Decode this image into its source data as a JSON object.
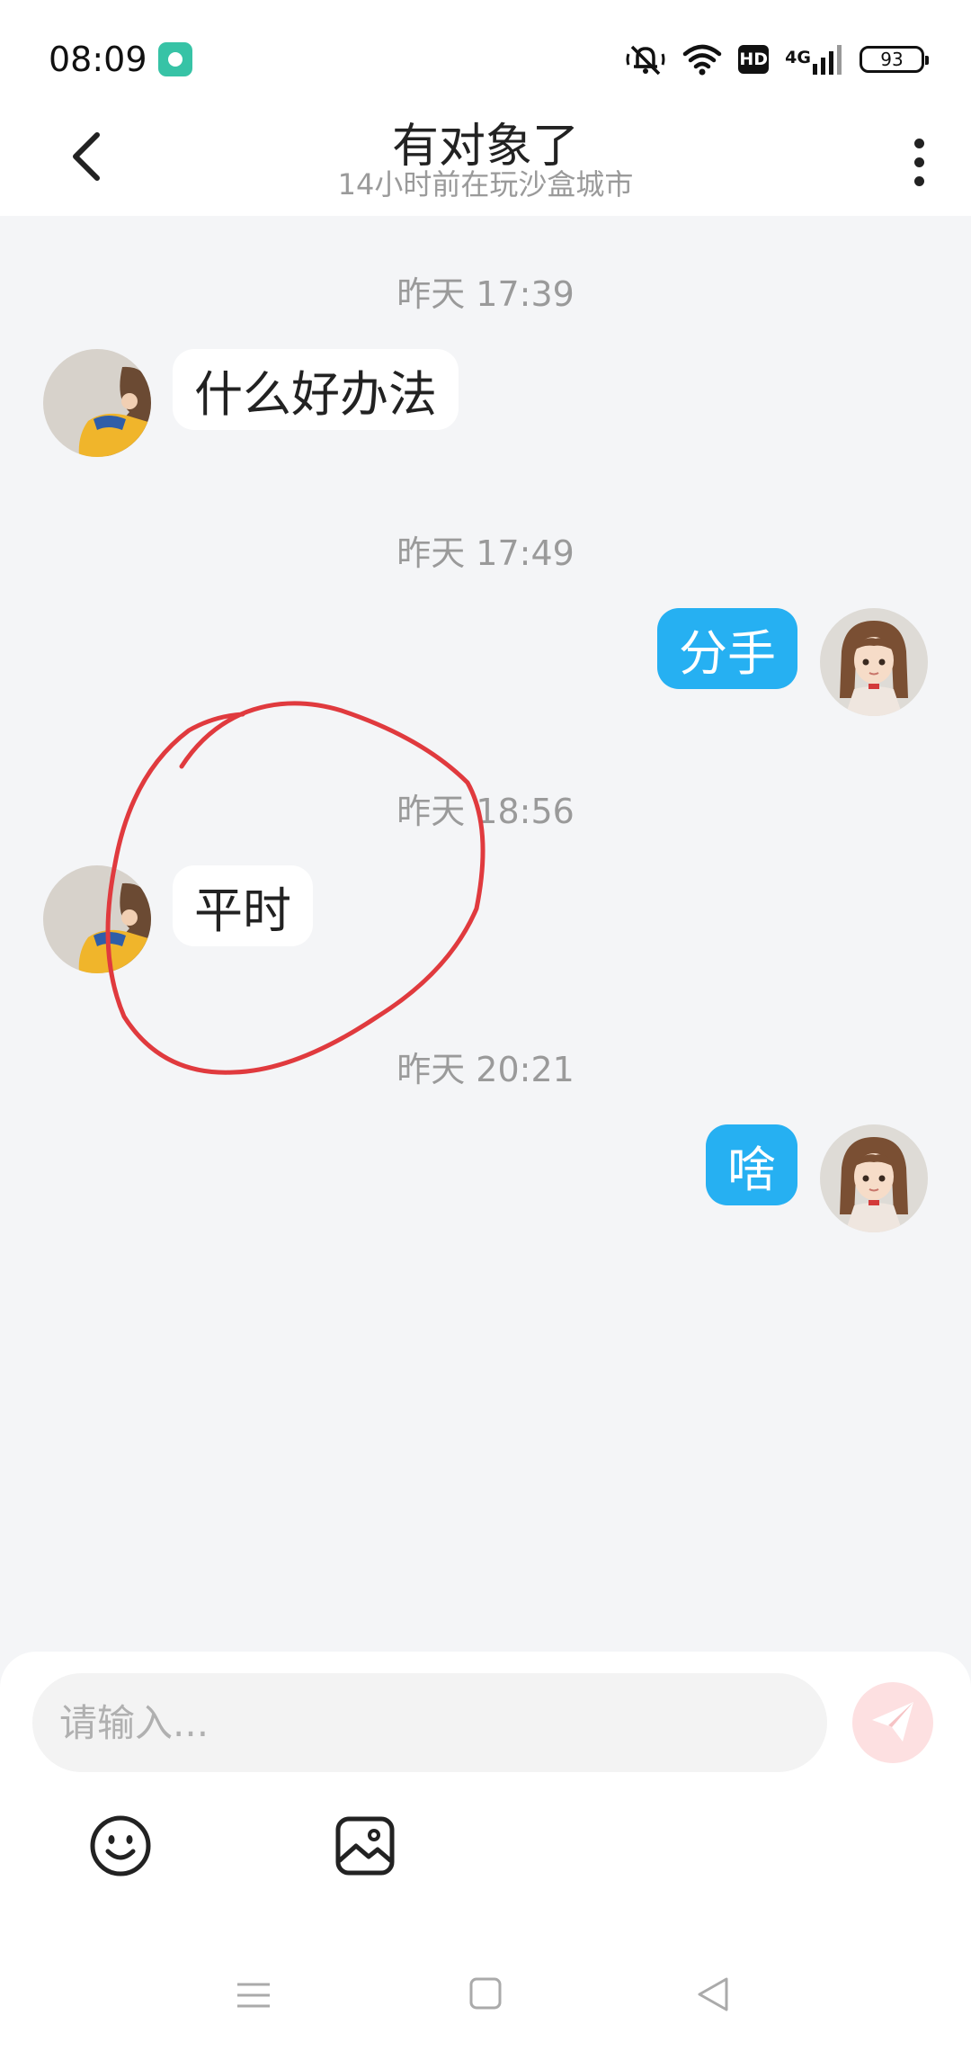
{
  "status_bar": {
    "time": "08:09",
    "hd": "HD",
    "network": "4G",
    "battery": "93",
    "icons": [
      "app-notification-icon",
      "mute-icon",
      "wifi-icon",
      "hd-icon",
      "signal-icon",
      "battery-icon"
    ]
  },
  "header": {
    "title": "有对象了",
    "subtitle": "14小时前在玩沙盒城市",
    "back_icon": "chevron-left-icon",
    "more_icon": "more-vertical-icon"
  },
  "messages": [
    {
      "time": "昨天 17:39",
      "sender": "other",
      "text": "什么好办法"
    },
    {
      "time": "昨天 17:49",
      "sender": "self",
      "text": "分手"
    },
    {
      "time": "昨天 18:56",
      "sender": "other",
      "text": "平时"
    },
    {
      "time": "昨天 20:21",
      "sender": "self",
      "text": "啥"
    }
  ],
  "input": {
    "placeholder": "请输入...",
    "value": "",
    "send_icon": "send-icon",
    "emoji_icon": "emoji-icon",
    "image_icon": "image-icon"
  },
  "nav": {
    "icons": [
      "menu-icon",
      "home-icon",
      "back-icon"
    ]
  },
  "colors": {
    "background": "#f4f5f7",
    "outgoing_bubble": "#26b0f2",
    "incoming_bubble": "#ffffff",
    "send_button": "#fde0e1",
    "annotation": "#e03a3e"
  }
}
